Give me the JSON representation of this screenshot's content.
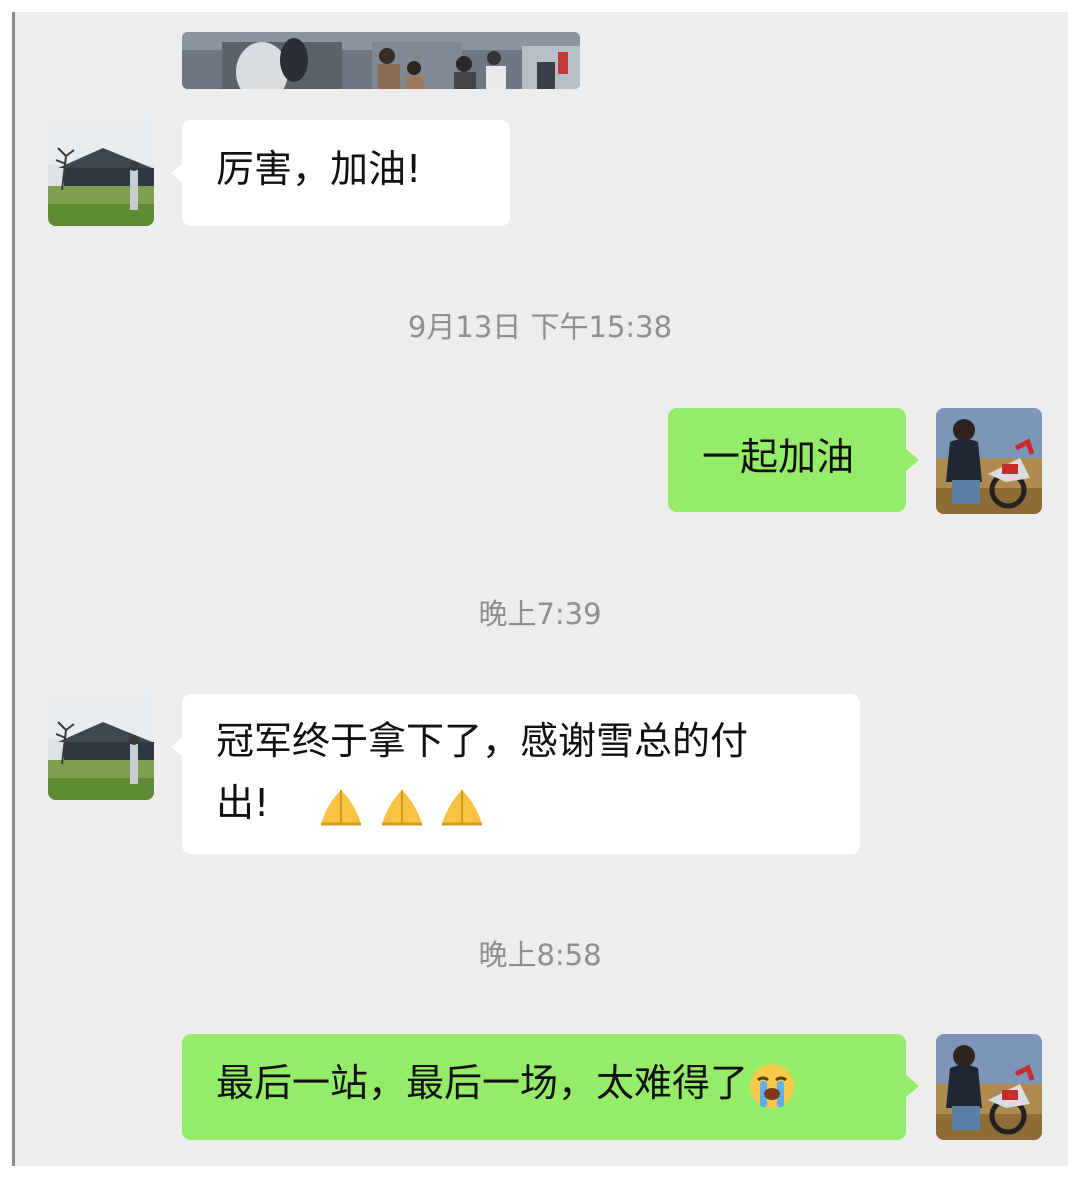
{
  "conversation": {
    "messages": [
      {
        "sender": "contact",
        "type": "image"
      },
      {
        "sender": "contact",
        "text": "厉害，加油!"
      },
      {
        "sender": "me",
        "text": "一起加油"
      },
      {
        "sender": "contact",
        "text_line1": "冠军终于拿下了，感谢雪总的付",
        "text_line2": "出!",
        "emoji": "folded-hands-emoji",
        "emoji_count": 3
      },
      {
        "sender": "me",
        "text": "最后一站，最后一场，太难得了",
        "emoji": "loudly-crying-face-emoji"
      }
    ],
    "timestamps": [
      "9月13日 下午15:38",
      "晚上7:39",
      "晚上8:58"
    ]
  },
  "theme": {
    "background": "#ededed",
    "incoming_bubble": "#ffffff",
    "outgoing_bubble": "#95ec69",
    "timestamp_color": "#8f8f8f"
  }
}
